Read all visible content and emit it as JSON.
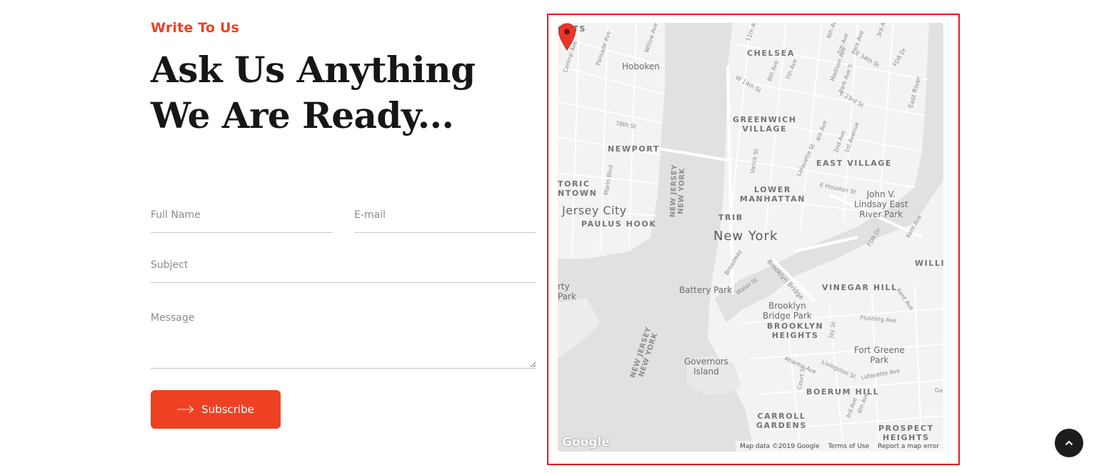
{
  "section": {
    "eyebrow": "Write To Us",
    "headline_line1": "Ask Us Anything",
    "headline_line2": "We Are Ready..."
  },
  "form": {
    "fullname_placeholder": "Full Name",
    "email_placeholder": "E-mail",
    "subject_placeholder": "Subject",
    "message_placeholder": "Message",
    "submit_label": "Subscribe",
    "submit_icon": "arrow-right-icon"
  },
  "map": {
    "labels": {
      "ghts": "GHTS",
      "chelsea": "CHELSEA",
      "hoboken": "Hoboken",
      "greenwich_village_1": "GREENWICH",
      "greenwich_village_2": "VILLAGE",
      "newport": "NEWPORT",
      "east_village": "EAST VILLAGE",
      "toric_1": "TORIC",
      "toric_2": "NTOWN",
      "lower_manhattan_1": "LOWER",
      "lower_manhattan_2": "MANHATTAN",
      "john_v_1": "John V.",
      "john_v_2": "Lindsay East",
      "john_v_3": "River Park",
      "jersey_city": "Jersey City",
      "paulus_hook": "PAULUS HOOK",
      "tribeca": "TRIB",
      "new_york": "New York",
      "willi": "WILLI",
      "vinegar_hill": "VINEGAR HILL",
      "battery_park": "Battery Park",
      "rty_1": "rty",
      "rty_2": "Park",
      "brooklyn_bridge_park_1": "Brooklyn",
      "brooklyn_bridge_park_2": "Bridge Park",
      "brooklyn_heights_1": "BROOKLYN",
      "brooklyn_heights_2": "HEIGHTS",
      "fort_greene_1": "Fort Greene",
      "fort_greene_2": "Park",
      "governors_1": "Governors",
      "governors_2": "Island",
      "boerum_hill": "BOERUM HILL",
      "carroll_gardens_1": "CARROLL",
      "carroll_gardens_2": "GARDENS",
      "prospect_heights_1": "PROSPECT",
      "prospect_heights_2": "HEIGHTS",
      "nj_ny_1a": "NEW JERSEY",
      "nj_ny_1b": "NEW YORK",
      "nj_ny_2a": "NEW JERSEY",
      "nj_ny_2b": "NEW YORK",
      "east_river": "East River",
      "brooklyn_bridge": "Brooklyn Bridge",
      "fdr_dr_1": "FDR Dr",
      "fdr_dr_2": "FDR Dr",
      "st_11th_ave": "11th Ave",
      "st_6th_ave": "6th Ave",
      "st_5th_ave": "5th Ave",
      "st_3rd_ave": "3rd Av",
      "st_park_ave": "Park Ave",
      "st_e34": "E 34th St",
      "st_madison": "Madison Ave",
      "st_park_s": "Park Ave S",
      "st_e23": "E 23rd St",
      "st_w14": "W 14th St",
      "st_8th": "8th Ave",
      "st_7th": "7th Ave",
      "st_central": "Central Ave",
      "st_palisade": "Palisade Ave",
      "st_willow": "Willow Ave",
      "st_78th": "78th St",
      "st_marin": "Marin Blvd",
      "st_varick": "Varick St",
      "st_lafayette": "Lafayette St",
      "st_4th": "4th Ave",
      "st_2nd": "2nd Ave",
      "st_1st": "1st Avenue",
      "st_e_houston": "E Houston St",
      "st_broadway": "Broadway",
      "st_water": "Water St",
      "st_kent": "Kent Ave",
      "st_kent2": "Kent Ave",
      "st_flushing": "Flushing Ave",
      "st_jay": "Jay St",
      "st_atlantic": "Atlantic Ave",
      "st_livingston": "Livingston St",
      "st_lafayette_ave": "Lafayette Ave",
      "st_court": "Court St",
      "st_3rd_ave2": "3rd Ave",
      "st_4th_ave2": "4th Ave",
      "st_ga": "Ga"
    },
    "logo": "Google",
    "attribution": {
      "data": "Map data ©2019 Google",
      "terms": "Terms of Use",
      "report": "Report a map error"
    },
    "pin_icon": "map-pin-icon",
    "colors": {
      "pin": "#e8372a",
      "frame": "#e01a1a"
    }
  },
  "back_to_top": {
    "icon": "chevron-up-icon"
  },
  "colors": {
    "accent": "#ee4123",
    "dark": "#1d1d1d"
  }
}
